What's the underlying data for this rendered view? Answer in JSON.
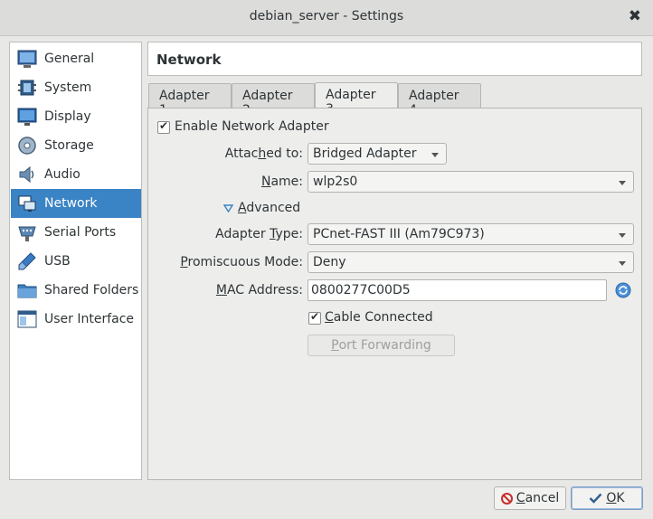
{
  "window": {
    "title": "debian_server - Settings",
    "close_glyph": "✖"
  },
  "sidebar": {
    "items": [
      {
        "label": "General",
        "icon": "general-icon"
      },
      {
        "label": "System",
        "icon": "system-icon"
      },
      {
        "label": "Display",
        "icon": "display-icon"
      },
      {
        "label": "Storage",
        "icon": "storage-icon"
      },
      {
        "label": "Audio",
        "icon": "audio-icon"
      },
      {
        "label": "Network",
        "icon": "network-icon",
        "selected": true
      },
      {
        "label": "Serial Ports",
        "icon": "serial-ports-icon"
      },
      {
        "label": "USB",
        "icon": "usb-icon"
      },
      {
        "label": "Shared Folders",
        "icon": "shared-folders-icon"
      },
      {
        "label": "User Interface",
        "icon": "user-interface-icon"
      }
    ]
  },
  "page": {
    "title": "Network",
    "tabs": [
      {
        "label_pre": "Adapter ",
        "label_ul": "1"
      },
      {
        "label_pre": "Adapter ",
        "label_ul": "2"
      },
      {
        "label_pre": "Adapter ",
        "label_ul": "3",
        "active": true
      },
      {
        "label_pre": "Adapter ",
        "label_ul": "4"
      }
    ]
  },
  "form": {
    "enable_adapter": {
      "label": "Enable Network Adapter",
      "checked": true
    },
    "attached_to": {
      "label_pre": "Attac",
      "label_ul": "h",
      "label_post": "ed to:",
      "value": "Bridged Adapter"
    },
    "name": {
      "label_pre": "",
      "label_ul": "N",
      "label_post": "ame:",
      "value": "wlp2s0"
    },
    "advanced": {
      "label_ul": "A",
      "label_post": "dvanced",
      "expanded": true
    },
    "adapter_type": {
      "label_pre": "Adapter ",
      "label_ul": "T",
      "label_post": "ype:",
      "value": "PCnet-FAST III (Am79C973)"
    },
    "promiscuous_mode": {
      "label_pre": "",
      "label_ul": "P",
      "label_post": "romiscuous Mode:",
      "value": "Deny"
    },
    "mac_address": {
      "label_pre": "",
      "label_ul": "M",
      "label_post": "AC Address:",
      "value": "0800277C00D5"
    },
    "cable_connected": {
      "label_ul": "C",
      "label_post": "able Connected",
      "checked": true
    },
    "port_forwarding": {
      "label_ul": "P",
      "label_post": "ort Forwarding",
      "enabled": false
    }
  },
  "footer": {
    "cancel": {
      "label_ul": "C",
      "label_post": "ancel"
    },
    "ok": {
      "label_ul": "O",
      "label_post": "K"
    }
  },
  "colors": {
    "accent": "#3a83c4",
    "window_bg": "#e8e8e7"
  }
}
